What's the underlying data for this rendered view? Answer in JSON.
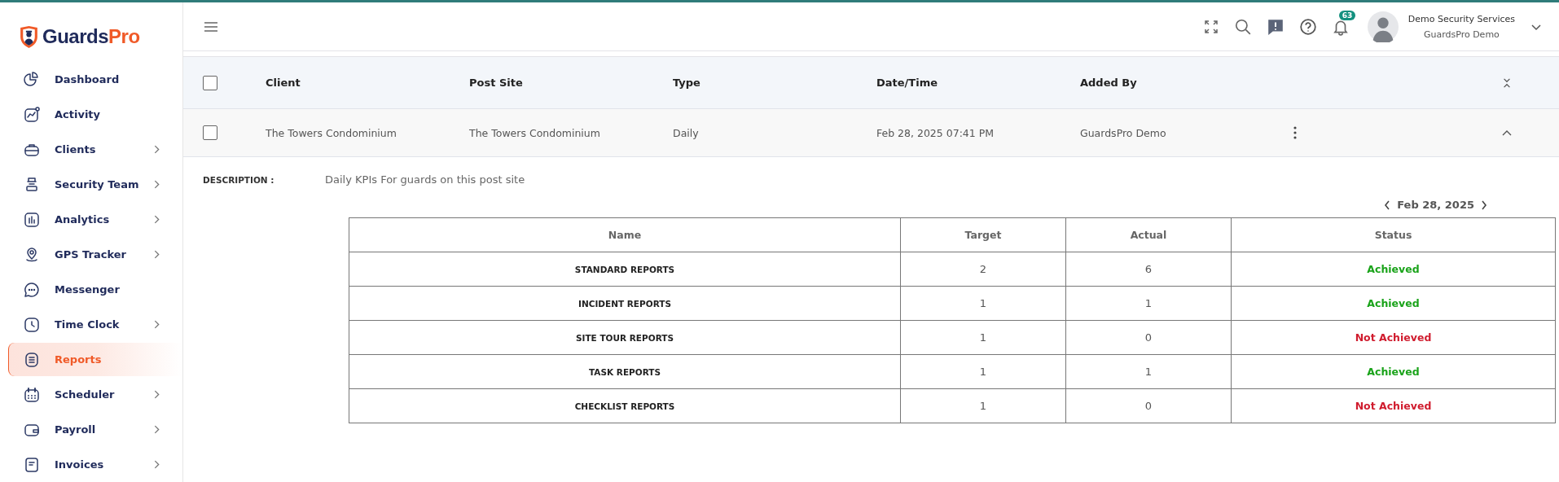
{
  "brand": {
    "name_part1": "Guards",
    "name_part2": "Pro"
  },
  "sidebar": {
    "items": [
      {
        "label": "Dashboard",
        "expandable": false,
        "selected": false
      },
      {
        "label": "Activity",
        "expandable": false,
        "selected": false
      },
      {
        "label": "Clients",
        "expandable": true,
        "selected": false
      },
      {
        "label": "Security Team",
        "expandable": true,
        "selected": false
      },
      {
        "label": "Analytics",
        "expandable": true,
        "selected": false
      },
      {
        "label": "GPS Tracker",
        "expandable": true,
        "selected": false
      },
      {
        "label": "Messenger",
        "expandable": false,
        "selected": false
      },
      {
        "label": "Time Clock",
        "expandable": true,
        "selected": false
      },
      {
        "label": "Reports",
        "expandable": false,
        "selected": true
      },
      {
        "label": "Scheduler",
        "expandable": true,
        "selected": false
      },
      {
        "label": "Payroll",
        "expandable": true,
        "selected": false
      },
      {
        "label": "Invoices",
        "expandable": true,
        "selected": false
      }
    ]
  },
  "header": {
    "notification_count": "63",
    "user": {
      "company": "Demo Security Services",
      "name": "GuardsPro Demo"
    }
  },
  "table": {
    "columns": [
      "Client",
      "Post Site",
      "Type",
      "Date/Time",
      "Added By"
    ],
    "header_checked": false,
    "rows": [
      {
        "checked": false,
        "expanded": true,
        "cells": [
          "The Towers Condominium",
          "The Towers Condominium",
          "Daily",
          "Feb 28, 2025 07:41 PM",
          "GuardsPro Demo"
        ]
      }
    ]
  },
  "detail": {
    "description_label": "DESCRIPTION :",
    "description": "Daily KPIs For guards on this post site",
    "date": "Feb 28, 2025",
    "kpi_columns": [
      "Name",
      "Target",
      "Actual",
      "Status"
    ],
    "kpis": [
      {
        "name": "STANDARD REPORTS",
        "target": "2",
        "actual": "6",
        "status": "Achieved",
        "achieved": true
      },
      {
        "name": "INCIDENT REPORTS",
        "target": "1",
        "actual": "1",
        "status": "Achieved",
        "achieved": true
      },
      {
        "name": "SITE TOUR REPORTS",
        "target": "1",
        "actual": "0",
        "status": "Not Achieved",
        "achieved": false
      },
      {
        "name": "TASK REPORTS",
        "target": "1",
        "actual": "1",
        "status": "Achieved",
        "achieved": true
      },
      {
        "name": "CHECKLIST REPORTS",
        "target": "1",
        "actual": "0",
        "status": "Not Achieved",
        "achieved": false
      }
    ]
  }
}
